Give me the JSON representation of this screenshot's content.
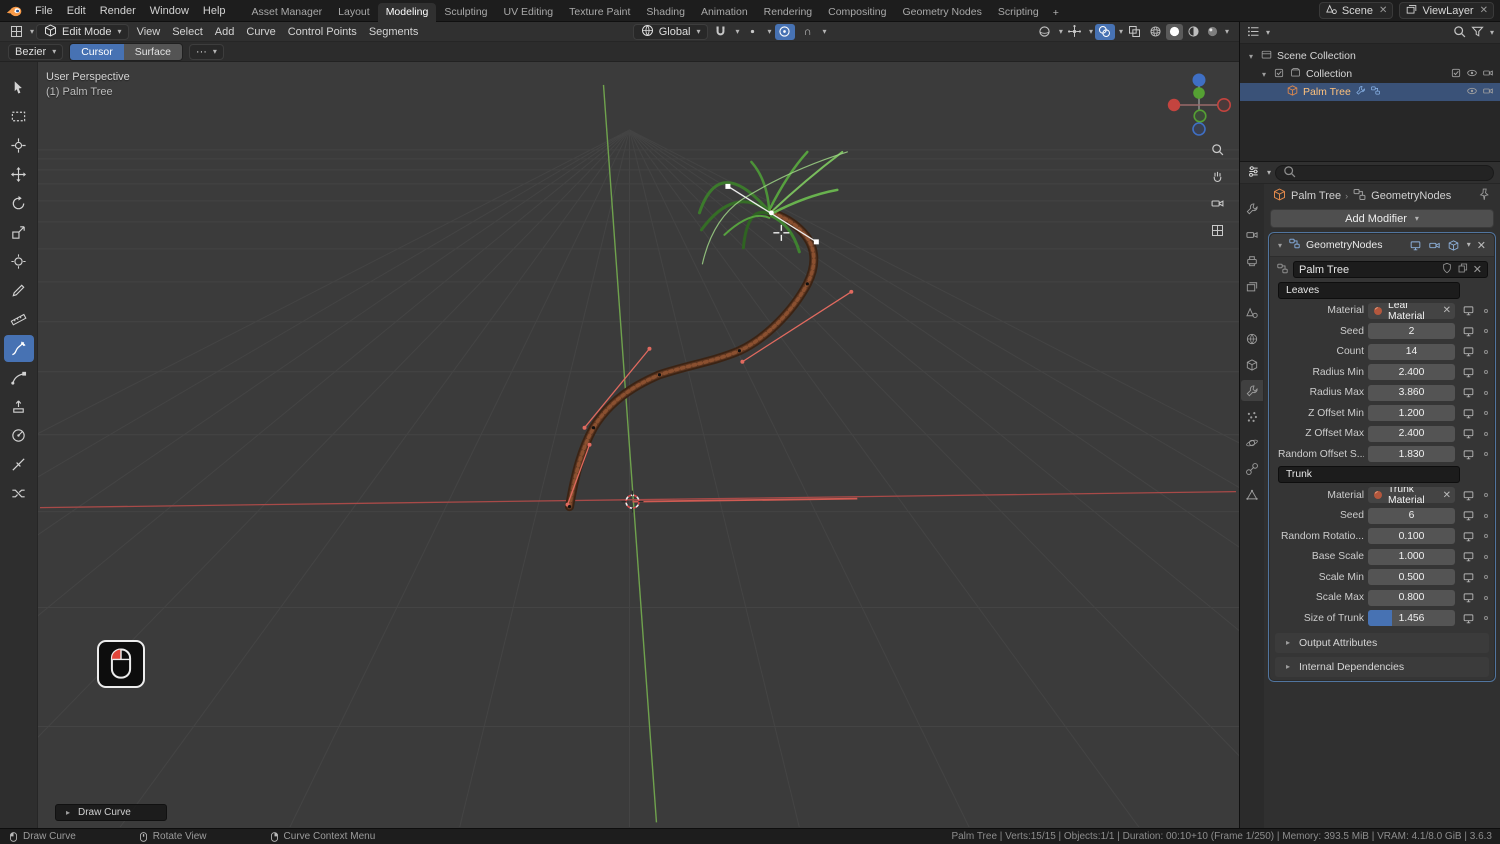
{
  "topbar": {
    "menus": [
      "File",
      "Edit",
      "Render",
      "Window",
      "Help"
    ],
    "workspaces": [
      "Asset Manager",
      "Layout",
      "Modeling",
      "Sculpting",
      "UV Editing",
      "Texture Paint",
      "Shading",
      "Animation",
      "Rendering",
      "Compositing",
      "Geometry Nodes",
      "Scripting"
    ],
    "active_workspace": "Modeling",
    "scene_label": "Scene",
    "viewlayer_label": "ViewLayer"
  },
  "header": {
    "mode": "Edit Mode",
    "menus": [
      "View",
      "Select",
      "Add",
      "Curve",
      "Control Points",
      "Segments"
    ],
    "orientation": "Global",
    "falloff": "∩",
    "tool_row": {
      "curve_type": "Bezier",
      "segments": [
        "Cursor",
        "Surface"
      ],
      "active_segment": "Cursor",
      "more": "···"
    }
  },
  "toolbar": {
    "tools": [
      "tweak",
      "select-box",
      "cursor",
      "move",
      "rotate",
      "scale",
      "transform",
      "annotate",
      "measure",
      "draw",
      "curve-pen",
      "extrude",
      "radius",
      "tilt",
      "randomize"
    ],
    "active": "draw"
  },
  "viewport": {
    "perspective_label": "User Perspective",
    "object_label": "(1) Palm Tree",
    "operator_panel": "Draw Curve"
  },
  "outliner": {
    "rows": [
      {
        "label": "Scene Collection",
        "level": 0,
        "icon": "scenecol",
        "expand": true,
        "right": []
      },
      {
        "label": "Collection",
        "level": 1,
        "icon": "collection",
        "expand": true,
        "check": true,
        "right": [
          "checkbox",
          "eye",
          "camera"
        ]
      },
      {
        "label": "Palm Tree",
        "level": 2,
        "icon": "cube",
        "selected": true,
        "tags": [
          "wrench",
          "nodes"
        ],
        "right": [
          "eye",
          "camera"
        ]
      }
    ]
  },
  "properties": {
    "tabs": [
      "tool",
      "render",
      "output",
      "viewlayer",
      "scene",
      "world",
      "object",
      "modifiers",
      "particles",
      "physics",
      "constraints",
      "data"
    ],
    "active_tab": "modifiers",
    "breadcrumb": {
      "object": "Palm Tree",
      "modifier": "GeometryNodes"
    },
    "add_modifier_label": "Add Modifier",
    "modifier": {
      "name": "GeometryNodes",
      "node_group": "Palm Tree",
      "rows": [
        {
          "type": "section",
          "label": "Leaves"
        },
        {
          "type": "material",
          "label": "Material",
          "value": "Leaf Material"
        },
        {
          "type": "number",
          "label": "Seed",
          "value": "2"
        },
        {
          "type": "number",
          "label": "Count",
          "value": "14"
        },
        {
          "type": "number",
          "label": "Radius Min",
          "value": "2.400"
        },
        {
          "type": "number",
          "label": "Radius Max",
          "value": "3.860"
        },
        {
          "type": "number",
          "label": "Z Offset Min",
          "value": "1.200"
        },
        {
          "type": "number",
          "label": "Z Offset Max",
          "value": "2.400"
        },
        {
          "type": "number",
          "label": "Random Offset S...",
          "value": "1.830"
        },
        {
          "type": "section",
          "label": "Trunk"
        },
        {
          "type": "material",
          "label": "Material",
          "value": "Trunk Material"
        },
        {
          "type": "number",
          "label": "Seed",
          "value": "6"
        },
        {
          "type": "number",
          "label": "Random Rotatio...",
          "value": "0.100"
        },
        {
          "type": "number",
          "label": "Base Scale",
          "value": "1.000"
        },
        {
          "type": "number",
          "label": "Scale Min",
          "value": "0.500"
        },
        {
          "type": "number",
          "label": "Scale Max",
          "value": "0.800"
        },
        {
          "type": "number",
          "label": "Size of Trunk",
          "value": "1.456",
          "slider": 0.28
        }
      ],
      "subpanels": [
        "Output Attributes",
        "Internal Dependencies"
      ]
    }
  },
  "statusbar": {
    "hints": [
      {
        "icon": "mouseL",
        "label": "Draw Curve"
      },
      {
        "icon": "mouseM",
        "label": "Rotate View"
      },
      {
        "icon": "mouseR",
        "label": "Curve Context Menu"
      }
    ],
    "info": "Palm Tree | Verts:15/15 | Objects:1/1 | Duration: 00:10+10 (Frame 1/250) | Memory: 393.5 MiB | VRAM: 4.1/8.0 GiB | 3.6.3"
  }
}
